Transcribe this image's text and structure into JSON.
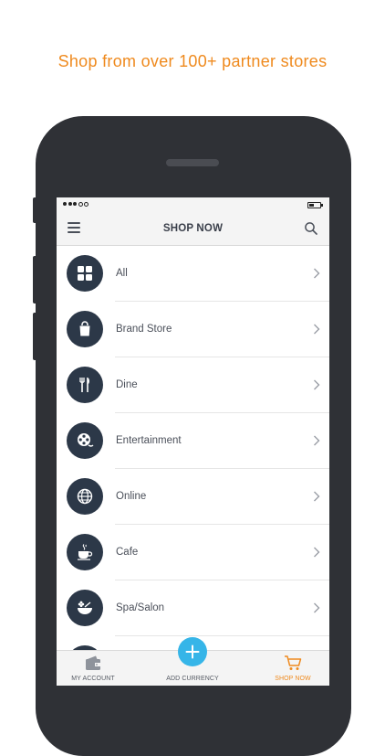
{
  "promo": {
    "headline": "Shop from over 100+ partner stores"
  },
  "header": {
    "title": "SHOP NOW",
    "menu_icon": "hamburger-icon",
    "search_icon": "search-icon"
  },
  "categories": [
    {
      "label": "All",
      "icon": "grid-icon"
    },
    {
      "label": "Brand Store",
      "icon": "shopping-bag-icon"
    },
    {
      "label": "Dine",
      "icon": "fork-knife-icon"
    },
    {
      "label": "Entertainment",
      "icon": "film-reel-icon"
    },
    {
      "label": "Online",
      "icon": "globe-icon"
    },
    {
      "label": "Cafe",
      "icon": "coffee-cup-icon"
    },
    {
      "label": "Spa/Salon",
      "icon": "spa-bowl-icon"
    }
  ],
  "tabbar": {
    "account": {
      "label": "MY ACCOUNT",
      "icon": "wallet-icon"
    },
    "add": {
      "label": "ADD CURRENCY",
      "icon": "plus-icon"
    },
    "shop": {
      "label": "SHOP NOW",
      "icon": "cart-icon"
    }
  },
  "colors": {
    "accent": "#ef8a1e",
    "icon_bg": "#2c3848",
    "fab": "#36b5e8",
    "frame": "#2f3136"
  }
}
